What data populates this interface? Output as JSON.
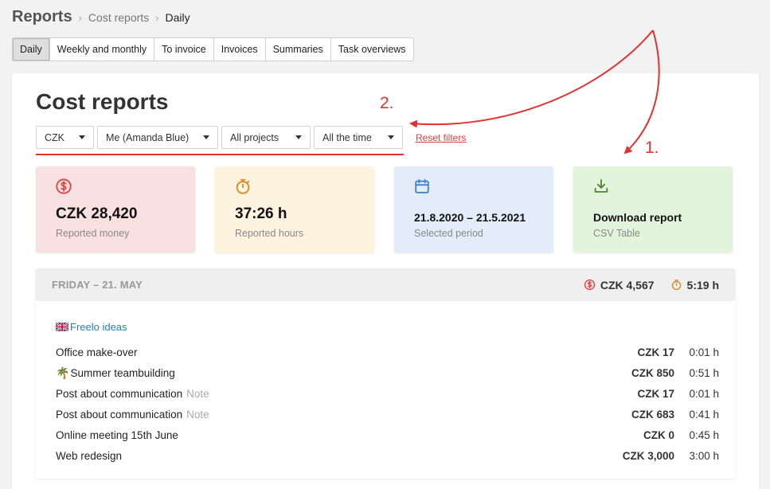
{
  "breadcrumb": {
    "root": "Reports",
    "sep": "›",
    "section": "Cost reports",
    "current": "Daily"
  },
  "tabs": [
    {
      "label": "Daily",
      "active": true
    },
    {
      "label": "Weekly and monthly"
    },
    {
      "label": "To invoice"
    },
    {
      "label": "Invoices"
    },
    {
      "label": "Summaries"
    },
    {
      "label": "Task overviews"
    }
  ],
  "page_title": "Cost reports",
  "filters": {
    "currency": "CZK",
    "user": "Me (Amanda Blue)",
    "projects": "All projects",
    "period": "All the time",
    "reset_label": "Reset filters"
  },
  "stats": {
    "money": {
      "value": "CZK 28,420",
      "label": "Reported money",
      "icon": "dollar-circle-icon",
      "color": "#e0413e",
      "bg": "#f9e1e1"
    },
    "hours": {
      "value": "37:26 h",
      "label": "Reported hours",
      "icon": "stopwatch-icon",
      "color": "#d98a1e",
      "bg": "#fdf3df"
    },
    "period": {
      "value": "21.8.2020 – 21.5.2021",
      "label": "Selected period",
      "icon": "calendar-icon",
      "color": "#3b82d6",
      "bg": "#e3edfa"
    },
    "download": {
      "value": "Download report",
      "label": "CSV Table",
      "icon": "download-icon",
      "color": "#4f8a2a",
      "bg": "#e2f5dc"
    }
  },
  "day": {
    "date": "FRIDAY – 21. MAY",
    "total_money": "CZK 4,567",
    "total_time": "5:19 h",
    "project": "Freelo ideas",
    "entries": [
      {
        "name": "Office make-over",
        "note": "",
        "amount": "CZK 17",
        "time": "0:01 h"
      },
      {
        "name": "Summer teambuilding",
        "note": "",
        "amount": "CZK 850",
        "time": "0:51 h",
        "emoji": "🌴"
      },
      {
        "name": "Post about communication",
        "note": "Note",
        "amount": "CZK 17",
        "time": "0:01 h"
      },
      {
        "name": "Post about communication",
        "note": "Note",
        "amount": "CZK 683",
        "time": "0:41 h"
      },
      {
        "name": "Online meeting 15th June",
        "note": "",
        "amount": "CZK 0",
        "time": "0:45 h"
      },
      {
        "name": "Web redesign",
        "note": "",
        "amount": "CZK 3,000",
        "time": "3:00 h"
      }
    ]
  },
  "annotations": {
    "one": "1.",
    "two": "2.",
    "color": "#e3312f"
  }
}
